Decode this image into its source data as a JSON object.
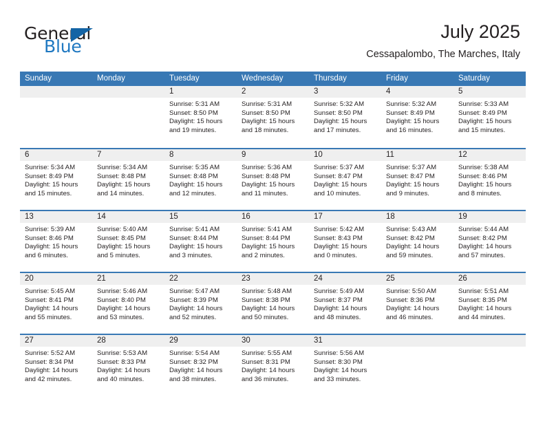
{
  "brand": {
    "name_top": "General",
    "name_bottom": "Blue",
    "accent_color": "#1f78c1",
    "triangle_color": "#1464a5"
  },
  "header": {
    "title": "July 2025",
    "subtitle": "Cessapalombo, The Marches, Italy"
  },
  "calendar": {
    "header_bg": "#3878b4",
    "daynum_band_bg": "#efefef",
    "weekdays": [
      "Sunday",
      "Monday",
      "Tuesday",
      "Wednesday",
      "Thursday",
      "Friday",
      "Saturday"
    ],
    "weeks": [
      [
        {
          "day": "",
          "lines": []
        },
        {
          "day": "",
          "lines": []
        },
        {
          "day": "1",
          "lines": [
            "Sunrise: 5:31 AM",
            "Sunset: 8:50 PM",
            "Daylight: 15 hours",
            "and 19 minutes."
          ]
        },
        {
          "day": "2",
          "lines": [
            "Sunrise: 5:31 AM",
            "Sunset: 8:50 PM",
            "Daylight: 15 hours",
            "and 18 minutes."
          ]
        },
        {
          "day": "3",
          "lines": [
            "Sunrise: 5:32 AM",
            "Sunset: 8:50 PM",
            "Daylight: 15 hours",
            "and 17 minutes."
          ]
        },
        {
          "day": "4",
          "lines": [
            "Sunrise: 5:32 AM",
            "Sunset: 8:49 PM",
            "Daylight: 15 hours",
            "and 16 minutes."
          ]
        },
        {
          "day": "5",
          "lines": [
            "Sunrise: 5:33 AM",
            "Sunset: 8:49 PM",
            "Daylight: 15 hours",
            "and 15 minutes."
          ]
        }
      ],
      [
        {
          "day": "6",
          "lines": [
            "Sunrise: 5:34 AM",
            "Sunset: 8:49 PM",
            "Daylight: 15 hours",
            "and 15 minutes."
          ]
        },
        {
          "day": "7",
          "lines": [
            "Sunrise: 5:34 AM",
            "Sunset: 8:48 PM",
            "Daylight: 15 hours",
            "and 14 minutes."
          ]
        },
        {
          "day": "8",
          "lines": [
            "Sunrise: 5:35 AM",
            "Sunset: 8:48 PM",
            "Daylight: 15 hours",
            "and 12 minutes."
          ]
        },
        {
          "day": "9",
          "lines": [
            "Sunrise: 5:36 AM",
            "Sunset: 8:48 PM",
            "Daylight: 15 hours",
            "and 11 minutes."
          ]
        },
        {
          "day": "10",
          "lines": [
            "Sunrise: 5:37 AM",
            "Sunset: 8:47 PM",
            "Daylight: 15 hours",
            "and 10 minutes."
          ]
        },
        {
          "day": "11",
          "lines": [
            "Sunrise: 5:37 AM",
            "Sunset: 8:47 PM",
            "Daylight: 15 hours",
            "and 9 minutes."
          ]
        },
        {
          "day": "12",
          "lines": [
            "Sunrise: 5:38 AM",
            "Sunset: 8:46 PM",
            "Daylight: 15 hours",
            "and 8 minutes."
          ]
        }
      ],
      [
        {
          "day": "13",
          "lines": [
            "Sunrise: 5:39 AM",
            "Sunset: 8:46 PM",
            "Daylight: 15 hours",
            "and 6 minutes."
          ]
        },
        {
          "day": "14",
          "lines": [
            "Sunrise: 5:40 AM",
            "Sunset: 8:45 PM",
            "Daylight: 15 hours",
            "and 5 minutes."
          ]
        },
        {
          "day": "15",
          "lines": [
            "Sunrise: 5:41 AM",
            "Sunset: 8:44 PM",
            "Daylight: 15 hours",
            "and 3 minutes."
          ]
        },
        {
          "day": "16",
          "lines": [
            "Sunrise: 5:41 AM",
            "Sunset: 8:44 PM",
            "Daylight: 15 hours",
            "and 2 minutes."
          ]
        },
        {
          "day": "17",
          "lines": [
            "Sunrise: 5:42 AM",
            "Sunset: 8:43 PM",
            "Daylight: 15 hours",
            "and 0 minutes."
          ]
        },
        {
          "day": "18",
          "lines": [
            "Sunrise: 5:43 AM",
            "Sunset: 8:42 PM",
            "Daylight: 14 hours",
            "and 59 minutes."
          ]
        },
        {
          "day": "19",
          "lines": [
            "Sunrise: 5:44 AM",
            "Sunset: 8:42 PM",
            "Daylight: 14 hours",
            "and 57 minutes."
          ]
        }
      ],
      [
        {
          "day": "20",
          "lines": [
            "Sunrise: 5:45 AM",
            "Sunset: 8:41 PM",
            "Daylight: 14 hours",
            "and 55 minutes."
          ]
        },
        {
          "day": "21",
          "lines": [
            "Sunrise: 5:46 AM",
            "Sunset: 8:40 PM",
            "Daylight: 14 hours",
            "and 53 minutes."
          ]
        },
        {
          "day": "22",
          "lines": [
            "Sunrise: 5:47 AM",
            "Sunset: 8:39 PM",
            "Daylight: 14 hours",
            "and 52 minutes."
          ]
        },
        {
          "day": "23",
          "lines": [
            "Sunrise: 5:48 AM",
            "Sunset: 8:38 PM",
            "Daylight: 14 hours",
            "and 50 minutes."
          ]
        },
        {
          "day": "24",
          "lines": [
            "Sunrise: 5:49 AM",
            "Sunset: 8:37 PM",
            "Daylight: 14 hours",
            "and 48 minutes."
          ]
        },
        {
          "day": "25",
          "lines": [
            "Sunrise: 5:50 AM",
            "Sunset: 8:36 PM",
            "Daylight: 14 hours",
            "and 46 minutes."
          ]
        },
        {
          "day": "26",
          "lines": [
            "Sunrise: 5:51 AM",
            "Sunset: 8:35 PM",
            "Daylight: 14 hours",
            "and 44 minutes."
          ]
        }
      ],
      [
        {
          "day": "27",
          "lines": [
            "Sunrise: 5:52 AM",
            "Sunset: 8:34 PM",
            "Daylight: 14 hours",
            "and 42 minutes."
          ]
        },
        {
          "day": "28",
          "lines": [
            "Sunrise: 5:53 AM",
            "Sunset: 8:33 PM",
            "Daylight: 14 hours",
            "and 40 minutes."
          ]
        },
        {
          "day": "29",
          "lines": [
            "Sunrise: 5:54 AM",
            "Sunset: 8:32 PM",
            "Daylight: 14 hours",
            "and 38 minutes."
          ]
        },
        {
          "day": "30",
          "lines": [
            "Sunrise: 5:55 AM",
            "Sunset: 8:31 PM",
            "Daylight: 14 hours",
            "and 36 minutes."
          ]
        },
        {
          "day": "31",
          "lines": [
            "Sunrise: 5:56 AM",
            "Sunset: 8:30 PM",
            "Daylight: 14 hours",
            "and 33 minutes."
          ]
        },
        {
          "day": "",
          "lines": []
        },
        {
          "day": "",
          "lines": []
        }
      ]
    ]
  }
}
